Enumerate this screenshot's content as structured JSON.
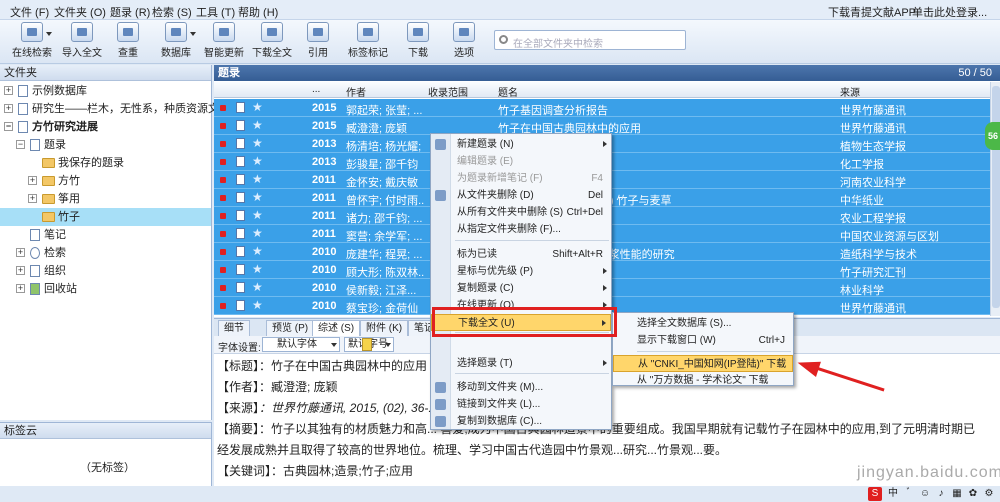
{
  "menubar": {
    "items": [
      "文件 (F)",
      "文件夹 (O)",
      "题录 (R)",
      "检索 (S)",
      "工具 (T)",
      "帮助 (H)"
    ],
    "app_link": "下载青提文献APP",
    "login": "单击此处登录..."
  },
  "toolbar": {
    "buttons": [
      "在线检索",
      "导入全文",
      "查重",
      "数据库",
      "智能更新",
      "下载全文",
      "引用",
      "标签标记",
      "下载",
      "选项"
    ],
    "search_placeholder": "在全部文件夹中检索"
  },
  "left": {
    "title": "文件夹",
    "tree": [
      "示例数据库",
      "研究生——栏木，无性系，种质资源文...",
      "方竹研究进展",
      "题录",
      "我保存的题录",
      "方竹",
      "筝用",
      "竹子",
      "笔记",
      "检索",
      "组织",
      "回收站"
    ],
    "tag_title": "标签云",
    "tag_empty": "（无标签）"
  },
  "grid": {
    "title": "题录",
    "count": "50 / 50",
    "headers": [
      "...",
      "作者",
      "收录范围",
      "题名",
      "来源"
    ],
    "rows": [
      {
        "year": "2015",
        "author": "郭起荣; 张莹; ...",
        "title": "竹子基因调查分析报告",
        "source": "世界竹藤通讯"
      },
      {
        "year": "2015",
        "author": "臧澄澄; 庞颖",
        "title": "竹子在中国古典园林中的应用",
        "source": "世界竹藤通讯"
      },
      {
        "year": "2013",
        "author": "杨清培; 杨光耀; ...",
        "title": "...吉效与机制",
        "source": "植物生态学报"
      },
      {
        "year": "2013",
        "author": "彭骏星; 邵千钧",
        "title": "...效果及其影响因素",
        "source": "化工学报"
      },
      {
        "year": "2011",
        "author": "金怀安; 戴庆敏",
        "title": "...质的影响",
        "source": "河南农业科学"
      },
      {
        "year": "2011",
        "author": "曾怀宇; 付时雨...",
        "title": "...状况与技术进步(之一) 竹子与麦草",
        "source": "中华纸业"
      },
      {
        "year": "2011",
        "author": "诸力; 邵千钧; ...",
        "title": "...浆获取可发酵单糖",
        "source": "农业工程学报"
      },
      {
        "year": "2011",
        "author": "窦营; 余学军; ...",
        "title": "...与发展对策",
        "source": "中国农业资源与区划"
      },
      {
        "year": "2010",
        "author": "庞建华; 程晃; ...",
        "title": "...纤维形态及其CMP制浆性能的研究",
        "source": "造纸科学与技术"
      },
      {
        "year": "2010",
        "author": "顾大形; 陈双林...",
        "title": "",
        "source": "竹子研究汇刊"
      },
      {
        "year": "2010",
        "author": "侯新毅; 江泽...",
        "title": "",
        "source": "林业科学"
      },
      {
        "year": "2010",
        "author": "蔡宝珍; 金荷仙",
        "title": "...中的应用",
        "source": "世界竹藤通讯"
      }
    ]
  },
  "tabs": [
    "细节",
    "预览 (P)",
    "综述 (S)",
    "附件 (K)",
    "笔记"
  ],
  "fontbar": {
    "label": "字体设置:",
    "font": "默认字体",
    "size": "默认字号"
  },
  "detail": {
    "title_label": "【标题】",
    "title_value": "：竹子在中国古典园林中的应用",
    "author_label": "【作者】",
    "author_value": "：臧澄澄; 庞颖",
    "source_label": "【来源】",
    "source_value": "：世界竹藤通讯, 2015, (02), 36-...",
    "abstract_label": "【摘要】",
    "abstract_value": "：竹子以其独有的材质魅力和高... 喜爱,成为中国古典园林造景中的重要组成。我国早期就有记载竹子在园林中的应用,到了元明清时期已经发展成熟并且取得了较高的世界地位。梳理、学习中国古代造园中竹景观...研究...竹景观...要。",
    "keywords_label": "【关键词】",
    "keywords_value": "：古典园林;造景;竹子;应用"
  },
  "context_menu": {
    "items": [
      {
        "label": "新建题录 (N)",
        "shortcut": "",
        "arrow": true,
        "disabled": false
      },
      {
        "label": "编辑题录 (E)",
        "shortcut": "",
        "arrow": false,
        "disabled": true
      },
      {
        "label": "为题录新增笔记 (F)",
        "shortcut": "F4",
        "arrow": false,
        "disabled": true
      },
      {
        "label": "从文件夹删除 (D)",
        "shortcut": "Del",
        "arrow": false,
        "disabled": false
      },
      {
        "label": "从所有文件夹中删除 (S)",
        "shortcut": "Ctrl+Del",
        "arrow": false,
        "disabled": false
      },
      {
        "label": "从指定文件夹删除 (F)...",
        "shortcut": "",
        "arrow": false,
        "disabled": false
      },
      {
        "label": "标为已读",
        "shortcut": "Shift+Alt+R",
        "arrow": false,
        "disabled": false
      },
      {
        "label": "星标与优先级 (P)",
        "shortcut": "",
        "arrow": true,
        "disabled": false
      },
      {
        "label": "复制题录 (C)",
        "shortcut": "",
        "arrow": true,
        "disabled": false
      },
      {
        "label": "在线更新 (O)",
        "shortcut": "",
        "arrow": true,
        "disabled": false
      },
      {
        "label": "下载全文 (U)",
        "shortcut": "",
        "arrow": true,
        "disabled": false
      },
      {
        "label": "选择题录 (T)",
        "shortcut": "",
        "arrow": true,
        "disabled": false
      },
      {
        "label": "移动到文件夹 (M)...",
        "shortcut": "",
        "arrow": false,
        "disabled": false
      },
      {
        "label": "链接到文件夹 (L)...",
        "shortcut": "",
        "arrow": false,
        "disabled": false
      },
      {
        "label": "复制到数据库 (C)...",
        "shortcut": "",
        "arrow": false,
        "disabled": false
      }
    ]
  },
  "submenu": {
    "items": [
      {
        "label": "选择全文数据库 (S)...",
        "shortcut": ""
      },
      {
        "label": "显示下载窗口 (W)",
        "shortcut": "Ctrl+J"
      },
      {
        "label": "从 \"CNKI_中国知网(IP登陆)\" 下载",
        "shortcut": ""
      },
      {
        "label": "从 \"万方数据 - 学术论文\" 下载",
        "shortcut": ""
      }
    ]
  },
  "watermark": "jingyan.baidu.com",
  "colors": {
    "selection": "#3aa0e8",
    "highlight": "#ffd66b",
    "annotation": "#e02020"
  }
}
